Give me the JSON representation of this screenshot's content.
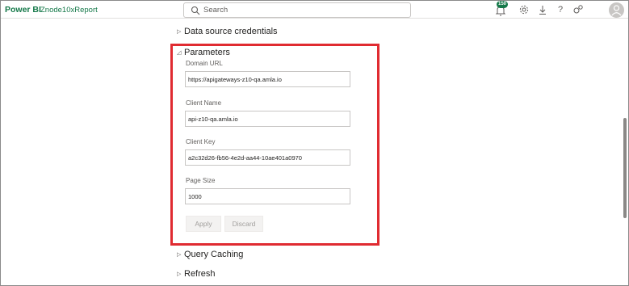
{
  "app": {
    "brand": "Power BI",
    "report_name": "Znode10xReport"
  },
  "search": {
    "placeholder": "Search"
  },
  "toolbar": {
    "notification_count": "150",
    "help_glyph": "?"
  },
  "sections": {
    "data_source_credentials": "Data source credentials",
    "parameters": "Parameters",
    "query_caching": "Query Caching",
    "refresh": "Refresh"
  },
  "parameters": {
    "domain_url": {
      "label": "Domain URL",
      "value": "https://apigateways-z10-qa.amla.io"
    },
    "client_name": {
      "label": "Client Name",
      "value": "api-z10-qa.amla.io"
    },
    "client_key": {
      "label": "Client Key",
      "value": "a2c32d26-fb56-4e2d-aa44-10ae401a0970"
    },
    "page_size": {
      "label": "Page Size",
      "value": "1000"
    }
  },
  "actions": {
    "apply": "Apply",
    "discard": "Discard"
  },
  "colors": {
    "brand": "#16794a",
    "highlight": "#e02b31"
  },
  "icons": [
    "search-icon",
    "notification-icon",
    "settings-icon",
    "download-icon",
    "help-icon",
    "share-icon",
    "avatar-icon"
  ]
}
